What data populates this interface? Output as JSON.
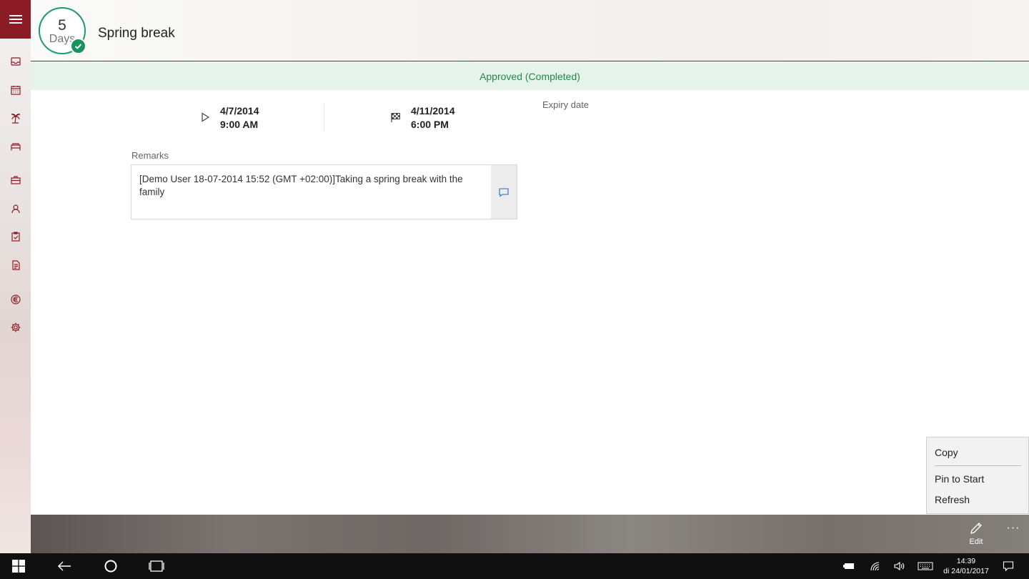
{
  "header": {
    "days_number": "5",
    "days_label": "Days",
    "title": "Spring break"
  },
  "status": {
    "text": "Approved (Completed)"
  },
  "dates": {
    "start_date": "4/7/2014",
    "start_time": "9:00 AM",
    "end_date": "4/11/2014",
    "end_time": "6:00 PM",
    "expiry_label": "Expiry date"
  },
  "remarks": {
    "label": "Remarks",
    "text": "[Demo User 18-07-2014 15:52 (GMT +02:00)]Taking a spring break with the family"
  },
  "nav": {
    "items": [
      "inbox-icon",
      "calendar-icon",
      "palm-tree-icon",
      "bed-icon",
      "briefcase-icon",
      "user-icon",
      "clipboard-check-icon",
      "document-icon",
      "euro-icon",
      "gear-icon"
    ]
  },
  "context_menu": {
    "items": [
      "Copy",
      "Pin to Start",
      "Refresh"
    ]
  },
  "cmdbar": {
    "edit_label": "Edit",
    "more_label": "···"
  },
  "taskbar": {
    "time": "14:39",
    "date": "di 24/01/2017"
  },
  "colors": {
    "brand": "#8b1c25",
    "approved": "#1f8a4c",
    "badge_ring": "#1f9a6a"
  }
}
